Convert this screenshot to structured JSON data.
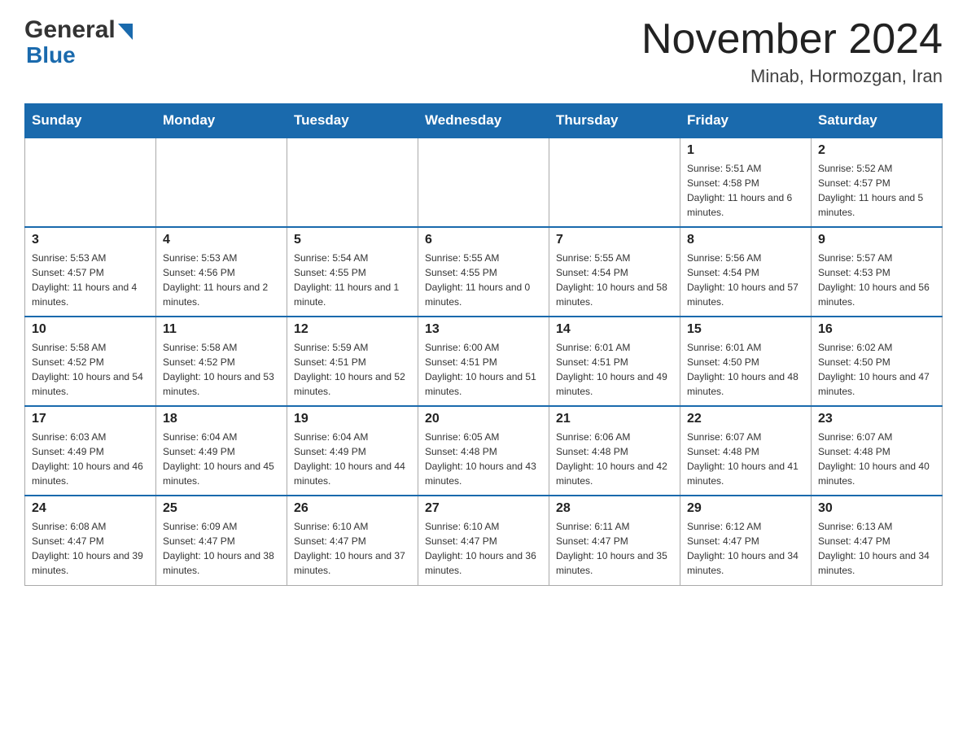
{
  "header": {
    "logo_general": "General",
    "logo_blue": "Blue",
    "month_title": "November 2024",
    "location": "Minab, Hormozgan, Iran"
  },
  "weekdays": [
    "Sunday",
    "Monday",
    "Tuesday",
    "Wednesday",
    "Thursday",
    "Friday",
    "Saturday"
  ],
  "weeks": [
    [
      {
        "day": "",
        "sunrise": "",
        "sunset": "",
        "daylight": ""
      },
      {
        "day": "",
        "sunrise": "",
        "sunset": "",
        "daylight": ""
      },
      {
        "day": "",
        "sunrise": "",
        "sunset": "",
        "daylight": ""
      },
      {
        "day": "",
        "sunrise": "",
        "sunset": "",
        "daylight": ""
      },
      {
        "day": "",
        "sunrise": "",
        "sunset": "",
        "daylight": ""
      },
      {
        "day": "1",
        "sunrise": "Sunrise: 5:51 AM",
        "sunset": "Sunset: 4:58 PM",
        "daylight": "Daylight: 11 hours and 6 minutes."
      },
      {
        "day": "2",
        "sunrise": "Sunrise: 5:52 AM",
        "sunset": "Sunset: 4:57 PM",
        "daylight": "Daylight: 11 hours and 5 minutes."
      }
    ],
    [
      {
        "day": "3",
        "sunrise": "Sunrise: 5:53 AM",
        "sunset": "Sunset: 4:57 PM",
        "daylight": "Daylight: 11 hours and 4 minutes."
      },
      {
        "day": "4",
        "sunrise": "Sunrise: 5:53 AM",
        "sunset": "Sunset: 4:56 PM",
        "daylight": "Daylight: 11 hours and 2 minutes."
      },
      {
        "day": "5",
        "sunrise": "Sunrise: 5:54 AM",
        "sunset": "Sunset: 4:55 PM",
        "daylight": "Daylight: 11 hours and 1 minute."
      },
      {
        "day": "6",
        "sunrise": "Sunrise: 5:55 AM",
        "sunset": "Sunset: 4:55 PM",
        "daylight": "Daylight: 11 hours and 0 minutes."
      },
      {
        "day": "7",
        "sunrise": "Sunrise: 5:55 AM",
        "sunset": "Sunset: 4:54 PM",
        "daylight": "Daylight: 10 hours and 58 minutes."
      },
      {
        "day": "8",
        "sunrise": "Sunrise: 5:56 AM",
        "sunset": "Sunset: 4:54 PM",
        "daylight": "Daylight: 10 hours and 57 minutes."
      },
      {
        "day": "9",
        "sunrise": "Sunrise: 5:57 AM",
        "sunset": "Sunset: 4:53 PM",
        "daylight": "Daylight: 10 hours and 56 minutes."
      }
    ],
    [
      {
        "day": "10",
        "sunrise": "Sunrise: 5:58 AM",
        "sunset": "Sunset: 4:52 PM",
        "daylight": "Daylight: 10 hours and 54 minutes."
      },
      {
        "day": "11",
        "sunrise": "Sunrise: 5:58 AM",
        "sunset": "Sunset: 4:52 PM",
        "daylight": "Daylight: 10 hours and 53 minutes."
      },
      {
        "day": "12",
        "sunrise": "Sunrise: 5:59 AM",
        "sunset": "Sunset: 4:51 PM",
        "daylight": "Daylight: 10 hours and 52 minutes."
      },
      {
        "day": "13",
        "sunrise": "Sunrise: 6:00 AM",
        "sunset": "Sunset: 4:51 PM",
        "daylight": "Daylight: 10 hours and 51 minutes."
      },
      {
        "day": "14",
        "sunrise": "Sunrise: 6:01 AM",
        "sunset": "Sunset: 4:51 PM",
        "daylight": "Daylight: 10 hours and 49 minutes."
      },
      {
        "day": "15",
        "sunrise": "Sunrise: 6:01 AM",
        "sunset": "Sunset: 4:50 PM",
        "daylight": "Daylight: 10 hours and 48 minutes."
      },
      {
        "day": "16",
        "sunrise": "Sunrise: 6:02 AM",
        "sunset": "Sunset: 4:50 PM",
        "daylight": "Daylight: 10 hours and 47 minutes."
      }
    ],
    [
      {
        "day": "17",
        "sunrise": "Sunrise: 6:03 AM",
        "sunset": "Sunset: 4:49 PM",
        "daylight": "Daylight: 10 hours and 46 minutes."
      },
      {
        "day": "18",
        "sunrise": "Sunrise: 6:04 AM",
        "sunset": "Sunset: 4:49 PM",
        "daylight": "Daylight: 10 hours and 45 minutes."
      },
      {
        "day": "19",
        "sunrise": "Sunrise: 6:04 AM",
        "sunset": "Sunset: 4:49 PM",
        "daylight": "Daylight: 10 hours and 44 minutes."
      },
      {
        "day": "20",
        "sunrise": "Sunrise: 6:05 AM",
        "sunset": "Sunset: 4:48 PM",
        "daylight": "Daylight: 10 hours and 43 minutes."
      },
      {
        "day": "21",
        "sunrise": "Sunrise: 6:06 AM",
        "sunset": "Sunset: 4:48 PM",
        "daylight": "Daylight: 10 hours and 42 minutes."
      },
      {
        "day": "22",
        "sunrise": "Sunrise: 6:07 AM",
        "sunset": "Sunset: 4:48 PM",
        "daylight": "Daylight: 10 hours and 41 minutes."
      },
      {
        "day": "23",
        "sunrise": "Sunrise: 6:07 AM",
        "sunset": "Sunset: 4:48 PM",
        "daylight": "Daylight: 10 hours and 40 minutes."
      }
    ],
    [
      {
        "day": "24",
        "sunrise": "Sunrise: 6:08 AM",
        "sunset": "Sunset: 4:47 PM",
        "daylight": "Daylight: 10 hours and 39 minutes."
      },
      {
        "day": "25",
        "sunrise": "Sunrise: 6:09 AM",
        "sunset": "Sunset: 4:47 PM",
        "daylight": "Daylight: 10 hours and 38 minutes."
      },
      {
        "day": "26",
        "sunrise": "Sunrise: 6:10 AM",
        "sunset": "Sunset: 4:47 PM",
        "daylight": "Daylight: 10 hours and 37 minutes."
      },
      {
        "day": "27",
        "sunrise": "Sunrise: 6:10 AM",
        "sunset": "Sunset: 4:47 PM",
        "daylight": "Daylight: 10 hours and 36 minutes."
      },
      {
        "day": "28",
        "sunrise": "Sunrise: 6:11 AM",
        "sunset": "Sunset: 4:47 PM",
        "daylight": "Daylight: 10 hours and 35 minutes."
      },
      {
        "day": "29",
        "sunrise": "Sunrise: 6:12 AM",
        "sunset": "Sunset: 4:47 PM",
        "daylight": "Daylight: 10 hours and 34 minutes."
      },
      {
        "day": "30",
        "sunrise": "Sunrise: 6:13 AM",
        "sunset": "Sunset: 4:47 PM",
        "daylight": "Daylight: 10 hours and 34 minutes."
      }
    ]
  ]
}
